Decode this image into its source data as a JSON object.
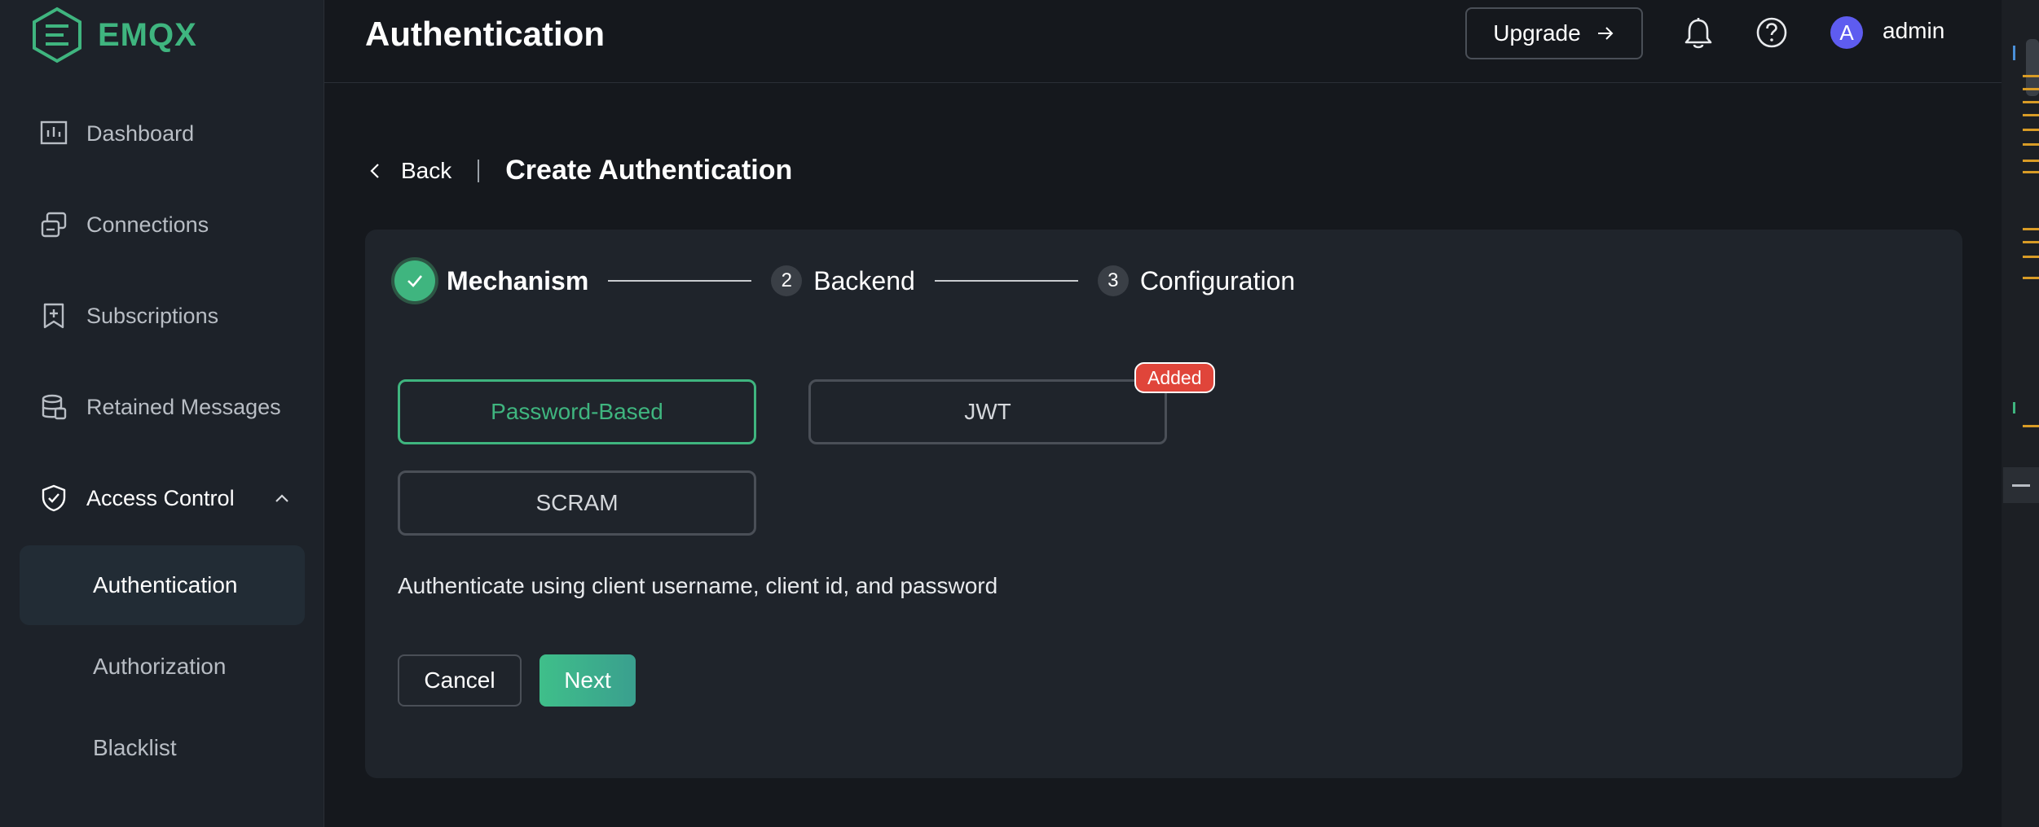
{
  "brand": {
    "name": "EMQX",
    "color": "#3fb57f"
  },
  "sidebar": {
    "items": [
      {
        "label": "Dashboard",
        "icon": "dashboard-icon"
      },
      {
        "label": "Connections",
        "icon": "connections-icon"
      },
      {
        "label": "Subscriptions",
        "icon": "subscriptions-icon"
      },
      {
        "label": "Retained Messages",
        "icon": "retained-messages-icon"
      },
      {
        "label": "Access Control",
        "icon": "shield-icon",
        "expanded": true
      }
    ],
    "sub_items": [
      {
        "label": "Authentication",
        "active": true
      },
      {
        "label": "Authorization"
      },
      {
        "label": "Blacklist"
      }
    ]
  },
  "header": {
    "title": "Authentication",
    "upgrade_label": "Upgrade",
    "username": "admin",
    "avatar_initial": "A"
  },
  "breadcrumb": {
    "back_label": "Back",
    "title": "Create Authentication"
  },
  "steps": [
    {
      "number": "",
      "label": "Mechanism",
      "status": "done"
    },
    {
      "number": "2",
      "label": "Backend",
      "status": "pending"
    },
    {
      "number": "3",
      "label": "Configuration",
      "status": "pending"
    }
  ],
  "mechanisms": {
    "password_based": "Password-Based",
    "jwt": "JWT",
    "scram": "SCRAM",
    "selected": "Password-Based",
    "added_badge": "Added"
  },
  "description": "Authenticate using client username, client id, and password",
  "actions": {
    "cancel_label": "Cancel",
    "next_label": "Next"
  },
  "colors": {
    "accent": "#3fb57f",
    "badge": "#e0453a",
    "background": "#15181d",
    "card": "#1f242b"
  }
}
